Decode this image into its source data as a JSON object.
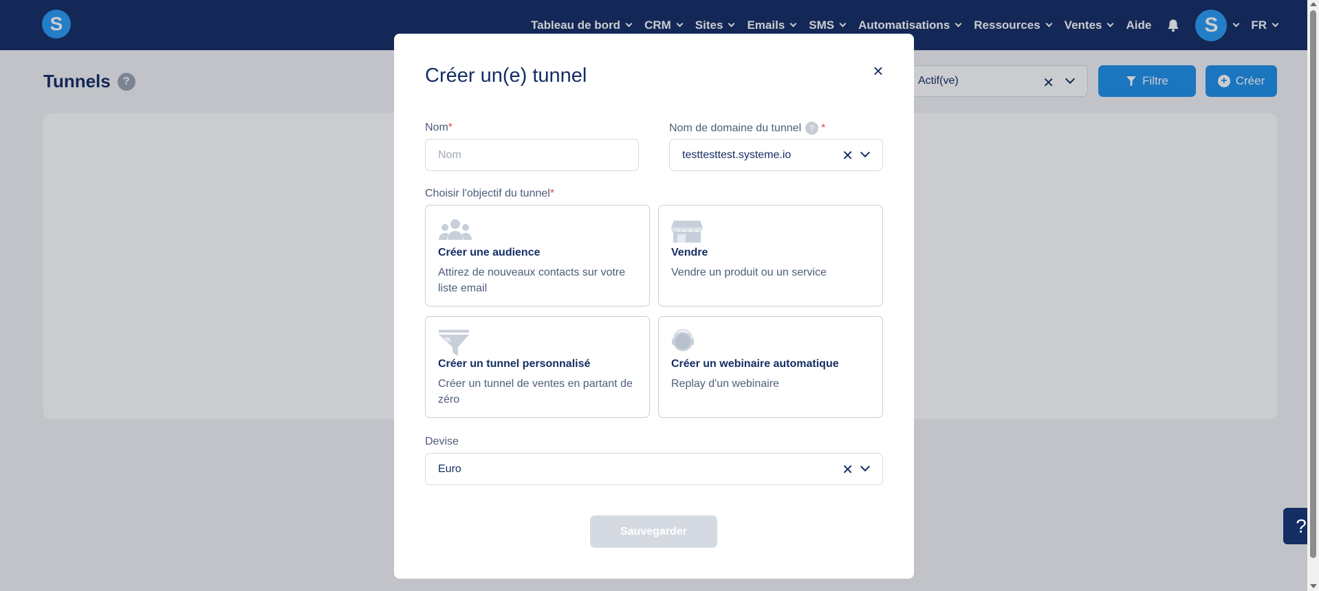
{
  "navbar": {
    "logo_letter": "S",
    "items": [
      {
        "label": "Tableau de bord",
        "dropdown": true
      },
      {
        "label": "CRM",
        "dropdown": true
      },
      {
        "label": "Sites",
        "dropdown": true
      },
      {
        "label": "Emails",
        "dropdown": true
      },
      {
        "label": "SMS",
        "dropdown": true
      },
      {
        "label": "Automatisations",
        "dropdown": true
      },
      {
        "label": "Ressources",
        "dropdown": true
      },
      {
        "label": "Ventes",
        "dropdown": true
      },
      {
        "label": "Aide",
        "dropdown": false
      }
    ],
    "avatar_letter": "S",
    "language": "FR"
  },
  "page": {
    "title": "Tunnels",
    "help_symbol": "?",
    "status_filter_value": "Actif(ve)",
    "filter_button": "Filtre",
    "create_button": "Créer"
  },
  "modal": {
    "title": "Créer un(e) tunnel",
    "close_symbol": "×",
    "name_label": "Nom",
    "name_placeholder": "Nom",
    "domain_label": "Nom de domaine du tunnel",
    "domain_value": "testtesttest.systeme.io",
    "objective_label": "Choisir l'objectif du tunnel",
    "required_mark": "*",
    "goals": [
      {
        "icon": "audience-icon",
        "title": "Créer une audience",
        "description": "Attirez de nouveaux contacts sur votre liste email"
      },
      {
        "icon": "store-icon",
        "title": "Vendre",
        "description": "Vendre un produit ou un service"
      },
      {
        "icon": "funnel-icon",
        "title": "Créer un tunnel personnalisé",
        "description": "Créer un tunnel de ventes en partant de zéro"
      },
      {
        "icon": "webinar-icon",
        "title": "Créer un webinaire automatique",
        "description": "Replay d'un webinaire"
      }
    ],
    "currency_label": "Devise",
    "currency_value": "Euro",
    "save_button": "Sauvegarder",
    "clear_symbol": "✕"
  },
  "help_float": "?",
  "colors": {
    "navbar_bg": "#142d63",
    "accent": "#1e90ea",
    "logo_blue": "#2a9bf4",
    "required": "#e5484d",
    "disabled_button": "#d5dae2"
  }
}
